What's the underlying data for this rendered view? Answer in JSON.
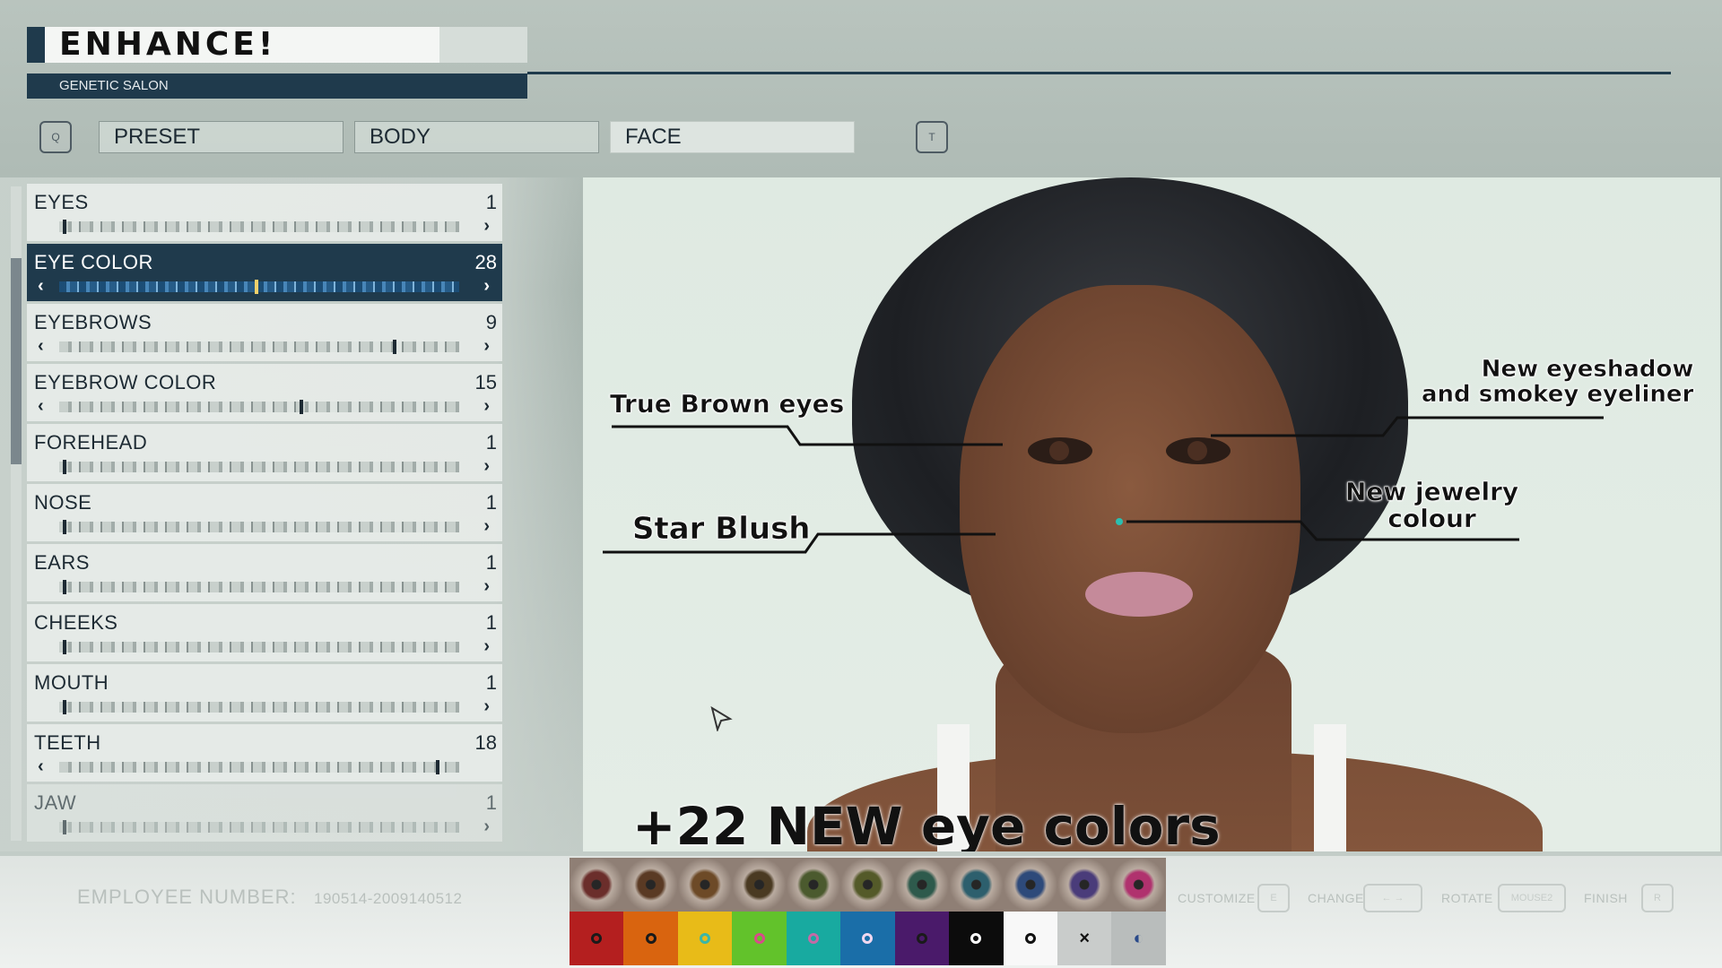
{
  "header": {
    "logo": "ENHANCE!",
    "subtitle": "GENETIC SALON"
  },
  "tabs": {
    "left_key": "Q",
    "right_key": "T",
    "items": [
      {
        "label": "PRESET"
      },
      {
        "label": "BODY"
      },
      {
        "label": "FACE"
      }
    ],
    "active": "FACE"
  },
  "sliders": [
    {
      "label": "EYES",
      "value": "1"
    },
    {
      "label": "EYE COLOR",
      "value": "28"
    },
    {
      "label": "EYEBROWS",
      "value": "9"
    },
    {
      "label": "EYEBROW COLOR",
      "value": "15"
    },
    {
      "label": "FOREHEAD",
      "value": "1"
    },
    {
      "label": "NOSE",
      "value": "1"
    },
    {
      "label": "EARS",
      "value": "1"
    },
    {
      "label": "CHEEKS",
      "value": "1"
    },
    {
      "label": "MOUTH",
      "value": "1"
    },
    {
      "label": "TEETH",
      "value": "18"
    },
    {
      "label": "JAW",
      "value": "1"
    }
  ],
  "annotations": {
    "brown_eyes": "True Brown eyes",
    "eyeshadow_1": "New eyeshadow",
    "eyeshadow_2": "and smokey eyeliner",
    "star_blush": "Star Blush",
    "jewelry_1": "New jewelry",
    "jewelry_2": "colour",
    "caption": "+22 NEW eye colors"
  },
  "footer": {
    "employee_label": "EMPLOYEE NUMBER:",
    "employee_number": "190514-2009140512",
    "hints": [
      {
        "label": "CUSTOMIZE",
        "key": "E"
      },
      {
        "label": "CHANGE",
        "key": "← →"
      },
      {
        "label": "ROTATE",
        "key": "MOUSE2"
      },
      {
        "label": "FINISH",
        "key": "R"
      }
    ]
  },
  "eye_swatches": [
    "#6b2e2b",
    "#5a3a24",
    "#6d4a27",
    "#4a3a22",
    "#4b5a2e",
    "#545a29",
    "#2e5a4c",
    "#2d5f6d",
    "#2e4a7a",
    "#4a3c7a",
    "#b0326e"
  ],
  "color_swatches": [
    {
      "color": "#b41f1f",
      "ring": "#1a1a1a",
      "mark": ""
    },
    {
      "color": "#d9640f",
      "ring": "#1a1a1a",
      "mark": ""
    },
    {
      "color": "#e8bb18",
      "ring": "#3bb6a6",
      "mark": ""
    },
    {
      "color": "#62c22b",
      "ring": "#d94a8a",
      "mark": ""
    },
    {
      "color": "#18aaa0",
      "ring": "#c46aa6",
      "mark": ""
    },
    {
      "color": "#1a6ea8",
      "ring": "#f0d8f0",
      "mark": ""
    },
    {
      "color": "#4a1a6a",
      "ring": "#1a1a1a",
      "mark": ""
    },
    {
      "color": "#0c0c0c",
      "ring": "#ffffff",
      "mark": ""
    },
    {
      "color": "#f8f8f8",
      "ring": "#111111",
      "mark": ""
    },
    {
      "color": "#c9cccb",
      "ring": "",
      "mark": "×"
    },
    {
      "color": "#b9bdbc",
      "ring": "",
      "mark": "◐"
    }
  ]
}
